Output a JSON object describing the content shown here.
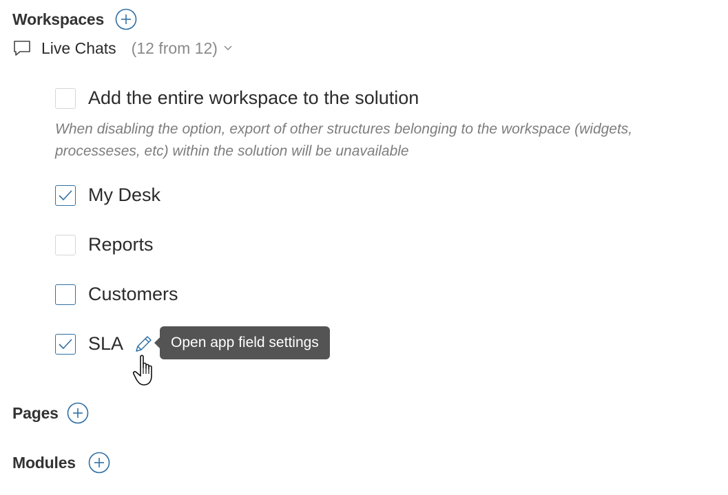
{
  "sections": {
    "workspaces": {
      "title": "Workspaces"
    },
    "pages": {
      "title": "Pages"
    },
    "modules": {
      "title": "Modules"
    }
  },
  "workspace_group": {
    "icon": "chat-bubble-icon",
    "label": "Live Chats",
    "count": "(12 from 12)",
    "expanded": true
  },
  "options": {
    "entire_workspace": {
      "label": "Add the entire workspace to the solution",
      "checked": false,
      "hint": "When disabling the option, export of other structures belonging to the workspace (widgets, processeses, etc) within the solution will be unavailable"
    },
    "items": [
      {
        "label": "My Desk",
        "checked": true
      },
      {
        "label": "Reports",
        "checked": false
      },
      {
        "label": "Customers",
        "checked": false
      },
      {
        "label": "SLA",
        "checked": true
      }
    ]
  },
  "tooltip": {
    "text": "Open app field settings"
  },
  "colors": {
    "accent": "#2f6fa4",
    "tooltip_bg": "#545454",
    "muted_text": "#8a8a8a"
  }
}
